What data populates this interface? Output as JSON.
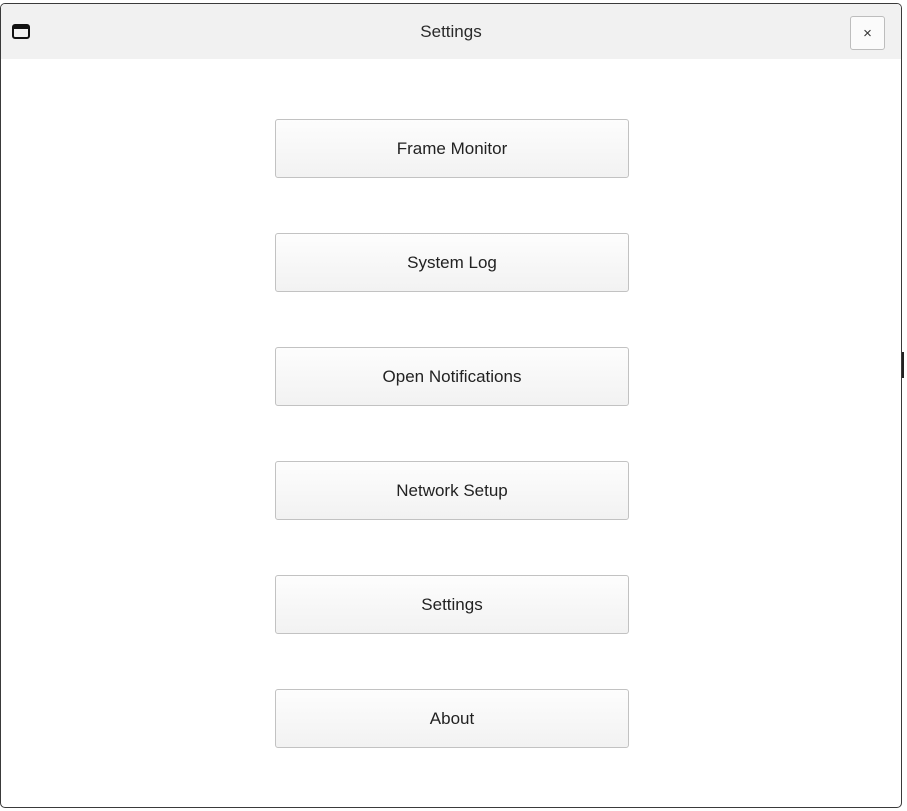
{
  "window": {
    "title": "Settings",
    "close_label": "×"
  },
  "menu": {
    "buttons": [
      {
        "label": "Frame Monitor"
      },
      {
        "label": "System Log"
      },
      {
        "label": "Open Notifications"
      },
      {
        "label": "Network Setup"
      },
      {
        "label": "Settings"
      },
      {
        "label": "About"
      }
    ]
  },
  "icons": {
    "window_icon": "window-icon",
    "close_icon": "close-icon"
  }
}
